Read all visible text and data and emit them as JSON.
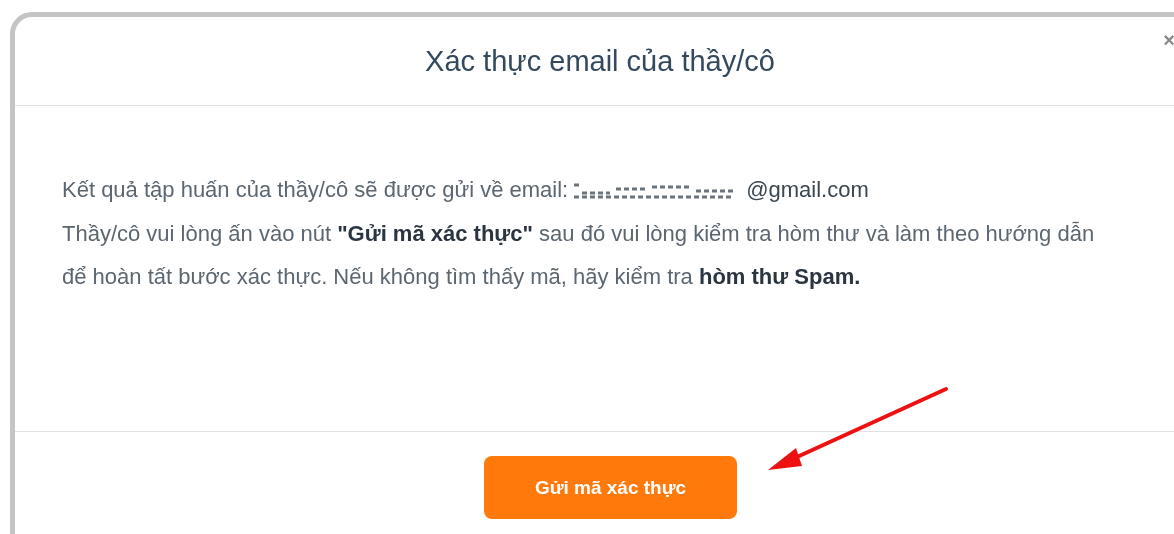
{
  "dialog": {
    "title": "Xác thực email của thầy/cô",
    "close": "×",
    "intro": "Kết quả tập huấn của thầy/cô sẽ được gửi về email:",
    "email": "@gmail.com",
    "instructions": "Thầy/cô vui lòng ấn vào nút **\"Gửi mã xác thực\"** sau đó vui lòng kiểm tra hòm thư và làm theo hướng dẫn để hoàn tất bước xác thực. Nếu không tìm thấy mã, hãy kiểm tra **hòm thư Spam.**",
    "button": "Gửi mã xác thực"
  }
}
